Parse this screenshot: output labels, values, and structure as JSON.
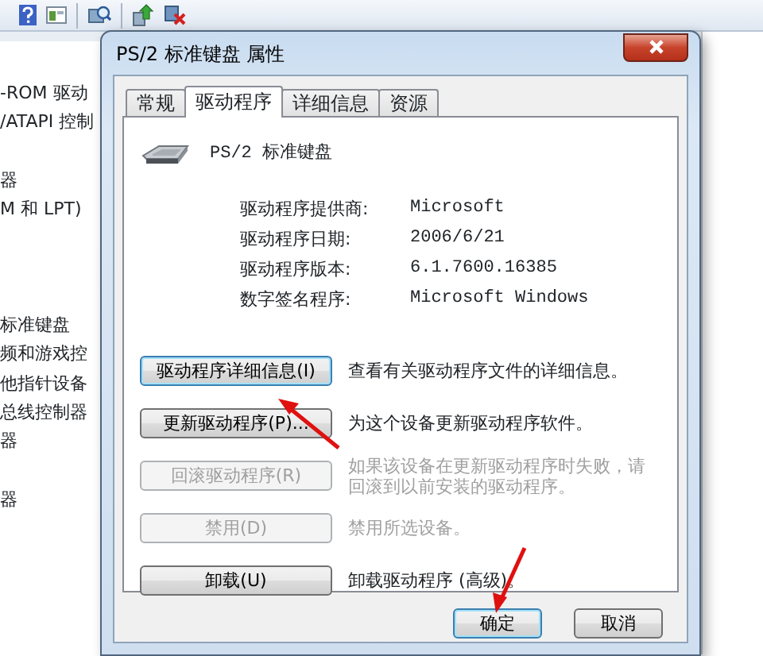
{
  "background_window": {
    "tree_groups": [
      [
        "-ROM 驱动",
        "/ATAPI 控制"
      ],
      [
        "器",
        "M 和 LPT)"
      ],
      [
        "标准键盘",
        "频和游戏控",
        "他指针设备",
        "总线控制器",
        "器"
      ],
      [
        "器"
      ]
    ]
  },
  "dialog": {
    "title": "PS/2 标准键盘 属性",
    "tabs": [
      {
        "label": "常规",
        "selected": false
      },
      {
        "label": "驱动程序",
        "selected": true
      },
      {
        "label": "详细信息",
        "selected": false
      },
      {
        "label": "资源",
        "selected": false
      }
    ],
    "device_name": "PS/2 标准键盘",
    "properties": [
      {
        "label": "驱动程序提供商:",
        "value": "Microsoft"
      },
      {
        "label": "驱动程序日期:",
        "value": "2006/6/21"
      },
      {
        "label": "驱动程序版本:",
        "value": "6.1.7600.16385"
      },
      {
        "label": "数字签名程序:",
        "value": "Microsoft Windows"
      }
    ],
    "actions": [
      {
        "button": "驱动程序详细信息(I)",
        "description": "查看有关驱动程序文件的详细信息。",
        "disabled": false
      },
      {
        "button": "更新驱动程序(P)...",
        "description": "为这个设备更新驱动程序软件。",
        "disabled": false
      },
      {
        "button": "回滚驱动程序(R)",
        "description": "如果该设备在更新驱动程序时失败，请回滚到以前安装的驱动程序。",
        "disabled": true
      },
      {
        "button": "禁用(D)",
        "description": "禁用所选设备。",
        "disabled": true
      },
      {
        "button": "卸载(U)",
        "description": "卸载驱动程序 (高级)。",
        "disabled": false
      }
    ],
    "footer_buttons": [
      {
        "label": "确定",
        "default": true
      },
      {
        "label": "取消",
        "default": false
      }
    ]
  }
}
